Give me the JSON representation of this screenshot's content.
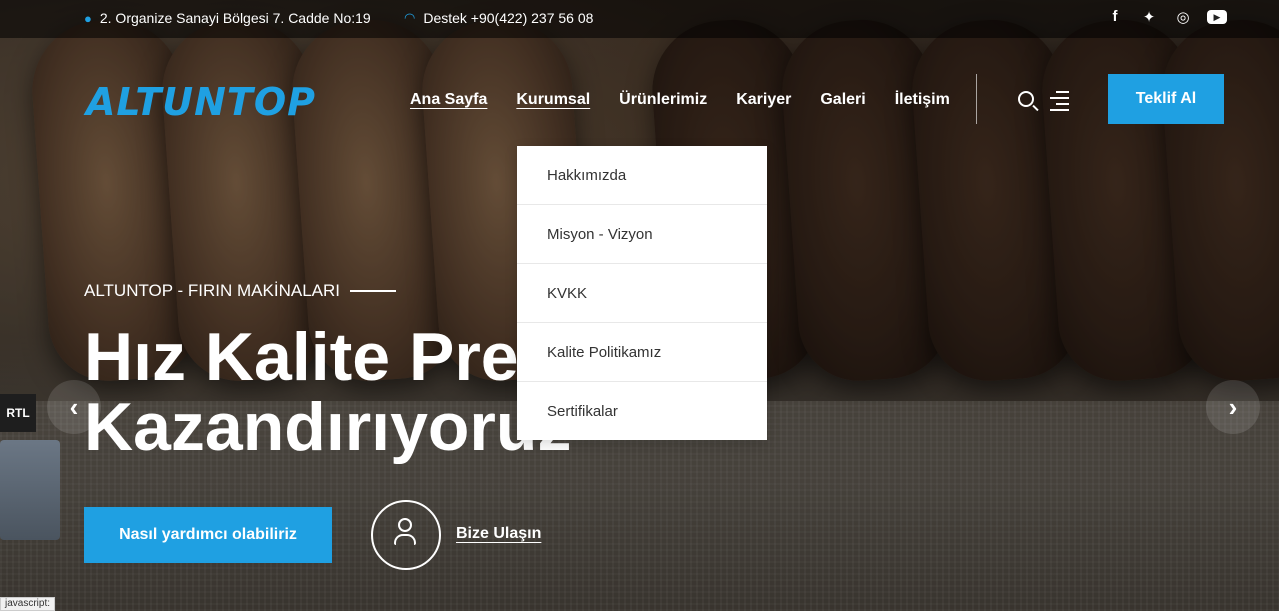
{
  "topbar": {
    "address": "2. Organize Sanayi Bölgesi 7. Cadde No:19",
    "support": "Destek +90(422) 237 56 08",
    "social_icons": [
      "facebook-icon",
      "twitter-icon",
      "instagram-icon",
      "youtube-icon"
    ]
  },
  "header": {
    "logo_text": "ALTUNTOP",
    "nav": [
      "Ana Sayfa",
      "Kurumsal",
      "Ürünlerimiz",
      "Kariyer",
      "Galeri",
      "İletişim"
    ],
    "quote_button": "Teklif Al"
  },
  "dropdown": {
    "items": [
      "Hakkımızda",
      "Misyon - Vizyon",
      "KVKK",
      "Kalite Politikamız",
      "Sertifikalar"
    ]
  },
  "hero": {
    "kicker": "ALTUNTOP - FIRIN MAKİNALARI",
    "headline_line1": "Hız Kalite Pre",
    "headline_line2": "Kazandırıyoruz",
    "cta_button": "Nasıl yardımcı olabiliriz",
    "contact_link": "Bize Ulaşın"
  },
  "misc": {
    "rtl_label": "RTL",
    "status_text": "javascript:",
    "prev_arrow": "‹",
    "next_arrow": "›"
  },
  "colors": {
    "accent": "#1fa0e2"
  }
}
